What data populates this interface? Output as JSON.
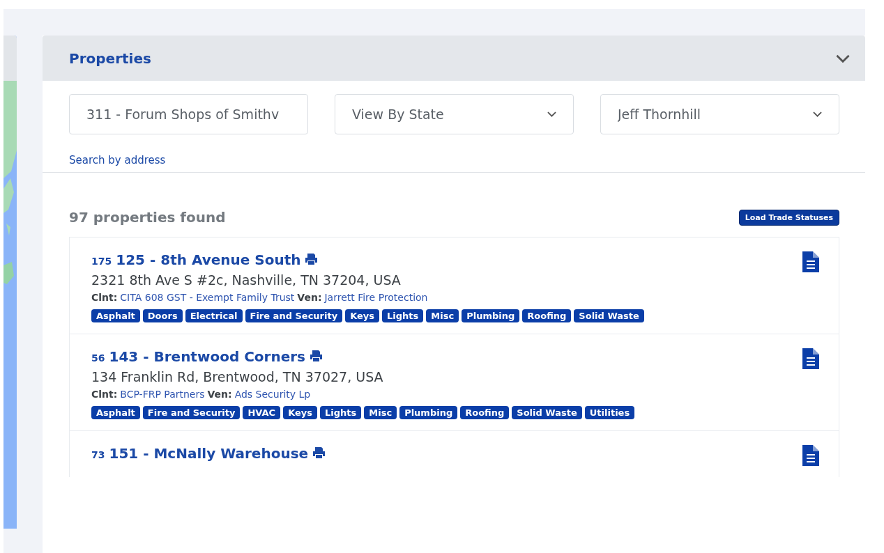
{
  "panel": {
    "title": "Properties"
  },
  "filters": {
    "property": {
      "value": "311 - Forum Shops of Smithv"
    },
    "state": {
      "value": "View By State"
    },
    "manager": {
      "value": "Jeff Thornhill"
    }
  },
  "search_link": "Search by address",
  "results": {
    "count": "97 properties found",
    "load_button": "Load Trade Statuses"
  },
  "properties": [
    {
      "number": "175",
      "name": "125 - 8th Avenue South",
      "address": "2321 8th Ave S #2c, Nashville, TN 37204, USA",
      "client_label": "Clnt:",
      "client": "CITA 608 GST - Exempt Family Trust",
      "vendor_label": "Ven:",
      "vendor": "Jarrett Fire Protection",
      "trades": [
        "Asphalt",
        "Doors",
        "Electrical",
        "Fire and Security",
        "Keys",
        "Lights",
        "Misc",
        "Plumbing",
        "Roofing",
        "Solid Waste"
      ]
    },
    {
      "number": "56",
      "name": "143 - Brentwood Corners",
      "address": "134 Franklin Rd, Brentwood, TN 37027, USA",
      "client_label": "Clnt:",
      "client": "BCP-FRP Partners",
      "vendor_label": "Ven:",
      "vendor": "Ads Security Lp",
      "trades": [
        "Asphalt",
        "Fire and Security",
        "HVAC",
        "Keys",
        "Lights",
        "Misc",
        "Plumbing",
        "Roofing",
        "Solid Waste",
        "Utilities"
      ]
    },
    {
      "number": "73",
      "name": "151 - McNally Warehouse"
    }
  ]
}
